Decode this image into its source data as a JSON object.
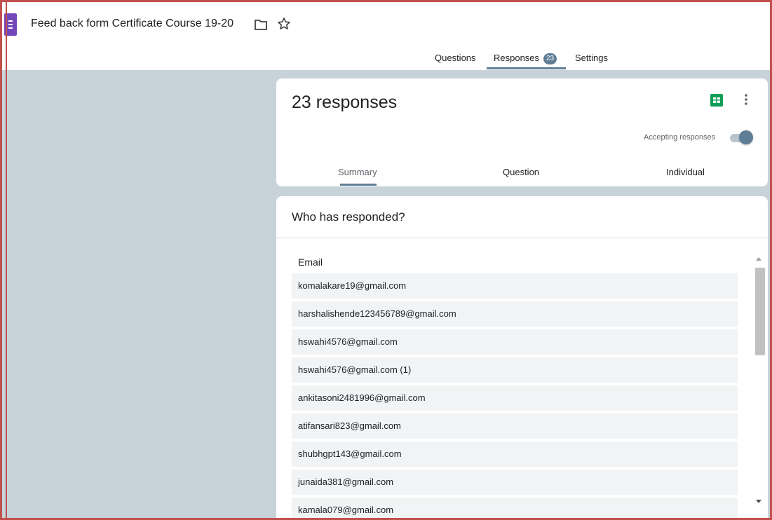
{
  "header": {
    "title": "Feed back form Certificate Course 19-20",
    "icons": [
      "forms-logo-icon",
      "folder-icon",
      "star-icon"
    ]
  },
  "top_tabs": {
    "questions": "Questions",
    "responses": "Responses",
    "responses_count": "23",
    "settings": "Settings",
    "active": "Responses"
  },
  "summary_card": {
    "count_text": "23 responses",
    "accepting_label": "Accepting responses",
    "accepting_on": true,
    "tabs": [
      "Summary",
      "Question",
      "Individual"
    ],
    "active_tab": "Summary"
  },
  "responders": {
    "heading": "Who has responded?",
    "column_header": "Email",
    "emails": [
      "komalakare19@gmail.com",
      "harshalishende123456789@gmail.com",
      "hswahi4576@gmail.com",
      "hswahi4576@gmail.com (1)",
      "ankitasoni2481996@gmail.com",
      "atifansari823@gmail.com",
      "shubhgpt143@gmail.com",
      "junaida381@gmail.com",
      "kamala079@gmail.com"
    ]
  },
  "colors": {
    "accent": "#5f7d95",
    "background": "#c8d3d9",
    "forms_purple": "#7248b9",
    "sheets_green": "#0f9d58",
    "frame_border": "#c0504d"
  }
}
